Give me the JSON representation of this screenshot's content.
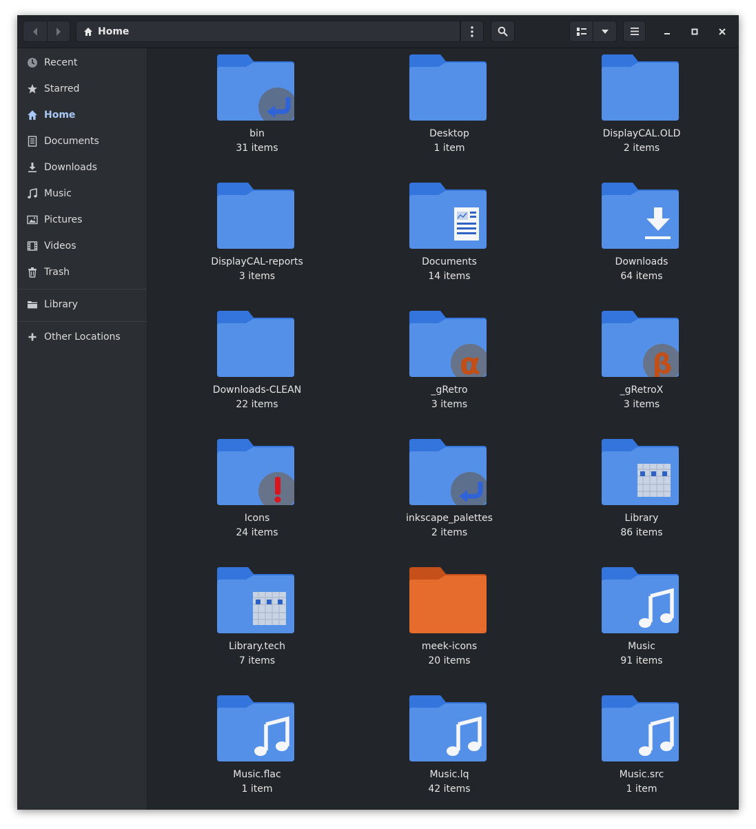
{
  "colors": {
    "window_bg": "#222529",
    "sidebar_bg": "#2b2e33",
    "folder_blue": "#5590e8",
    "folder_orange": "#e56c2c",
    "accent": "#a9c8f5"
  },
  "headerbar": {
    "back_icon": "go-back-icon",
    "forward_icon": "go-forward-icon",
    "location_icon": "home-icon",
    "location_label": "Home",
    "path_menu_icon": "vertical-dots-icon",
    "search_icon": "search-icon",
    "view_icon": "list-view-icon",
    "view_options_icon": "chevron-down-icon",
    "main_menu_icon": "hamburger-icon",
    "minimize_icon": "minimize-icon",
    "maximize_icon": "maximize-icon",
    "close_icon": "close-icon"
  },
  "sidebar": {
    "items": [
      {
        "label": "Recent",
        "icon": "clock-icon"
      },
      {
        "label": "Starred",
        "icon": "star-icon"
      },
      {
        "label": "Home",
        "icon": "home-icon",
        "active": true
      },
      {
        "label": "Documents",
        "icon": "document-icon"
      },
      {
        "label": "Downloads",
        "icon": "download-icon"
      },
      {
        "label": "Music",
        "icon": "music-icon"
      },
      {
        "label": "Pictures",
        "icon": "picture-icon"
      },
      {
        "label": "Videos",
        "icon": "video-icon"
      },
      {
        "label": "Trash",
        "icon": "trash-icon"
      }
    ],
    "bookmarks": [
      {
        "label": "Library",
        "icon": "folder-icon"
      }
    ],
    "other": {
      "label": "Other Locations",
      "icon": "plus-icon"
    }
  },
  "files": [
    {
      "name": "bin",
      "count": "31 items",
      "emblem": "symlink-emblem",
      "color": "blue"
    },
    {
      "name": "Desktop",
      "count": "1 item",
      "emblem": "",
      "color": "blue"
    },
    {
      "name": "DisplayCAL.OLD",
      "count": "2 items",
      "emblem": "",
      "color": "blue"
    },
    {
      "name": "DisplayCAL-reports",
      "count": "3 items",
      "emblem": "",
      "color": "blue"
    },
    {
      "name": "Documents",
      "count": "14 items",
      "emblem": "document-glyph",
      "color": "blue"
    },
    {
      "name": "Downloads",
      "count": "64 items",
      "emblem": "download-glyph",
      "color": "blue"
    },
    {
      "name": "Downloads-CLEAN",
      "count": "22 items",
      "emblem": "",
      "color": "blue"
    },
    {
      "name": "_gRetro",
      "count": "3 items",
      "emblem": "alpha-emblem",
      "color": "blue"
    },
    {
      "name": "_gRetroX",
      "count": "3 items",
      "emblem": "beta-emblem",
      "color": "blue"
    },
    {
      "name": "Icons",
      "count": "24 items",
      "emblem": "important-emblem",
      "color": "blue"
    },
    {
      "name": "inkscape_palettes",
      "count": "2 items",
      "emblem": "symlink-emblem",
      "color": "blue"
    },
    {
      "name": "Library",
      "count": "86 items",
      "emblem": "library-glyph",
      "color": "blue"
    },
    {
      "name": "Library.tech",
      "count": "7 items",
      "emblem": "library-glyph",
      "color": "blue"
    },
    {
      "name": "meek-icons",
      "count": "20 items",
      "emblem": "",
      "color": "orange"
    },
    {
      "name": "Music",
      "count": "91 items",
      "emblem": "music-glyph",
      "color": "blue"
    },
    {
      "name": "Music.flac",
      "count": "1 item",
      "emblem": "music-glyph",
      "color": "blue"
    },
    {
      "name": "Music.lq",
      "count": "42 items",
      "emblem": "music-glyph",
      "color": "blue"
    },
    {
      "name": "Music.src",
      "count": "1 item",
      "emblem": "music-glyph",
      "color": "blue"
    }
  ]
}
